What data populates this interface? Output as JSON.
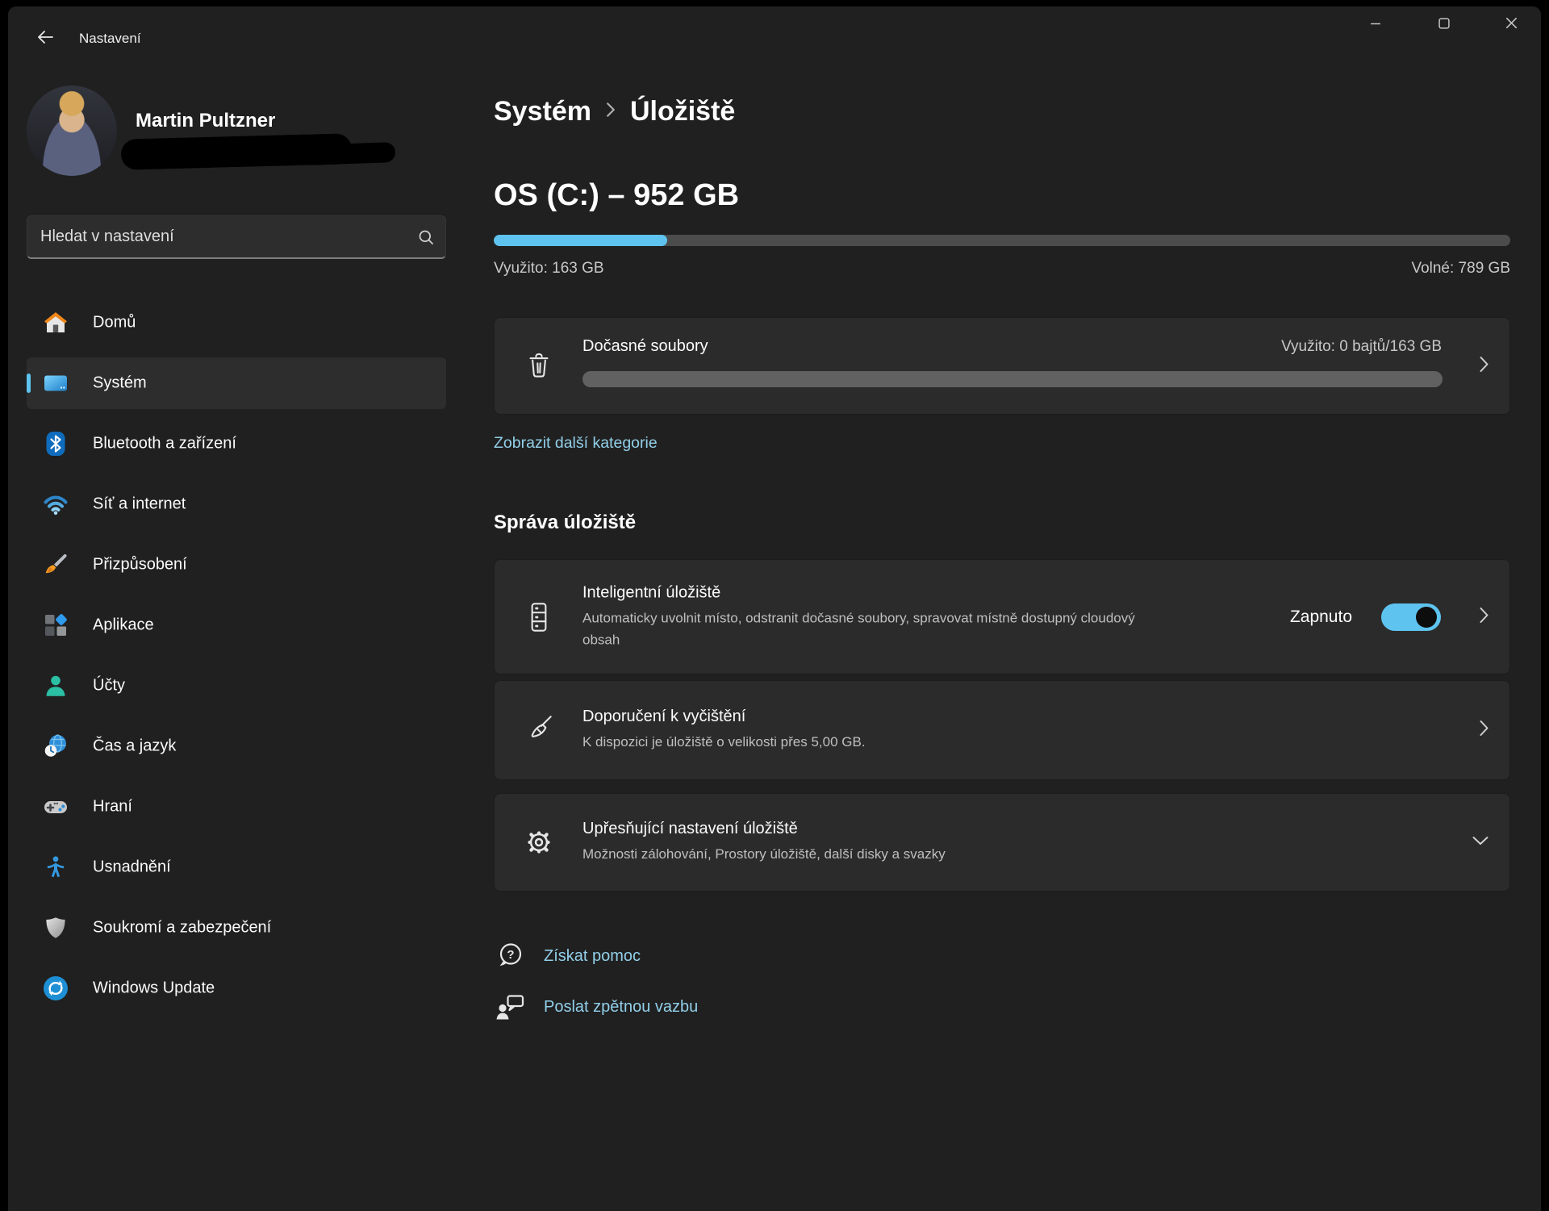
{
  "titlebar": {
    "title": "Nastavení"
  },
  "user": {
    "name": "Martin Pultzner"
  },
  "search": {
    "placeholder": "Hledat v nastavení"
  },
  "sidebar": {
    "items": [
      {
        "label": "Domů",
        "icon": "home-icon",
        "selected": false
      },
      {
        "label": "Systém",
        "icon": "system-icon",
        "selected": true
      },
      {
        "label": "Bluetooth a zařízení",
        "icon": "bluetooth-icon",
        "selected": false
      },
      {
        "label": "Síť a internet",
        "icon": "network-icon",
        "selected": false
      },
      {
        "label": "Přizpůsobení",
        "icon": "personalization-icon",
        "selected": false
      },
      {
        "label": "Aplikace",
        "icon": "apps-icon",
        "selected": false
      },
      {
        "label": "Účty",
        "icon": "accounts-icon",
        "selected": false
      },
      {
        "label": "Čas a jazyk",
        "icon": "time-language-icon",
        "selected": false
      },
      {
        "label": "Hraní",
        "icon": "gaming-icon",
        "selected": false
      },
      {
        "label": "Usnadnění",
        "icon": "accessibility-icon",
        "selected": false
      },
      {
        "label": "Soukromí a zabezpečení",
        "icon": "privacy-icon",
        "selected": false
      },
      {
        "label": "Windows Update",
        "icon": "windows-update-icon",
        "selected": false
      }
    ]
  },
  "breadcrumb": {
    "parent": "Systém",
    "current": "Úložiště"
  },
  "drive": {
    "title": "OS (C:) – 952 GB",
    "used_label": "Využito: 163 GB",
    "free_label": "Volné: 789 GB",
    "used_percent": 17.1
  },
  "temp_files": {
    "title": "Dočasné soubory",
    "usage_label": "Využito: 0 bajtů/163 GB",
    "used_percent": 0
  },
  "links": {
    "show_more": "Zobrazit další kategorie"
  },
  "storage_management": {
    "heading": "Správa úložiště",
    "cards": [
      {
        "title": "Inteligentní úložiště",
        "subtitle": "Automaticky uvolnit místo, odstranit dočasné soubory, spravovat místně dostupný cloudový obsah",
        "toggle_label": "Zapnuto",
        "toggle_on": true,
        "icon": "smart-storage-icon",
        "chevron": "right"
      },
      {
        "title": "Doporučení k vyčištění",
        "subtitle": "K dispozici je úložiště o velikosti přes 5,00 GB.",
        "icon": "cleanup-broom-icon",
        "chevron": "right"
      },
      {
        "title": "Upřesňující nastavení úložiště",
        "subtitle": "Možnosti zálohování, Prostory úložiště, další disky a svazky",
        "icon": "gear-icon",
        "chevron": "down"
      }
    ]
  },
  "footer": {
    "links": [
      {
        "label": "Získat pomoc",
        "icon": "get-help-icon"
      },
      {
        "label": "Poslat zpětnou vazbu",
        "icon": "feedback-icon"
      }
    ]
  },
  "colors": {
    "accent": "#5ec3ef",
    "link": "#92cfe9",
    "window_bg": "#202020",
    "card_bg": "#2b2b2b"
  }
}
